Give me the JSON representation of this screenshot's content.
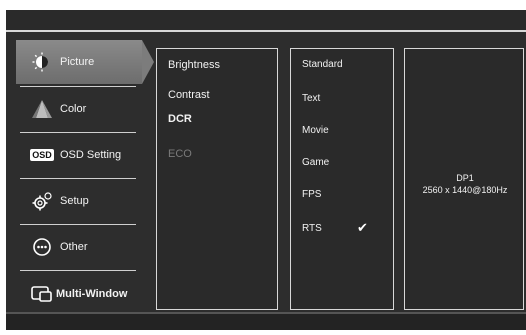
{
  "menu": {
    "items": [
      {
        "label": "Picture",
        "icon": "picture-icon",
        "active": true
      },
      {
        "label": "Color",
        "icon": "color-icon"
      },
      {
        "label": "OSD Setting",
        "icon": "osd-icon"
      },
      {
        "label": "Setup",
        "icon": "gear-icon"
      },
      {
        "label": "Other",
        "icon": "other-icon"
      },
      {
        "label": "Multi-Window",
        "icon": "multi-window-icon"
      }
    ]
  },
  "picture_options": [
    {
      "label": "Brightness"
    },
    {
      "label": "Contrast"
    },
    {
      "label": "DCR"
    },
    {
      "label": "ECO"
    }
  ],
  "eco_modes": [
    {
      "label": "Standard"
    },
    {
      "label": "Text"
    },
    {
      "label": "Movie"
    },
    {
      "label": "Game"
    },
    {
      "label": "FPS"
    },
    {
      "label": "RTS",
      "selected": true
    }
  ],
  "input_info": {
    "source": "DP1",
    "resolution": "2560 x 1440@180Hz"
  },
  "osd_text": {
    "osd_icon_label": "OSD"
  },
  "colors": {
    "background": "#2d2d2d",
    "active_item": "#7c7c7c",
    "border": "#d8d8d8",
    "text": "#f2f2f2",
    "disabled_text": "#7a7a7a"
  }
}
